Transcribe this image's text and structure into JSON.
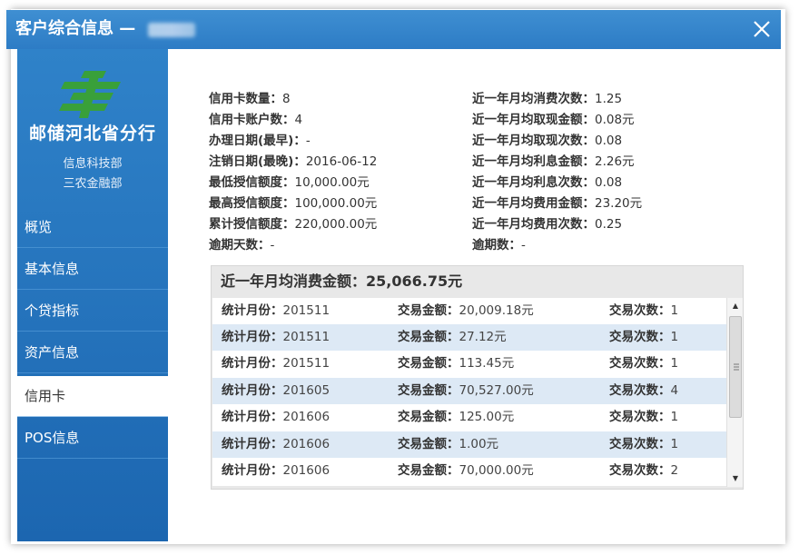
{
  "window": {
    "title": "客户综合信息 —",
    "close_icon": "close-icon"
  },
  "sidebar": {
    "org_name": "邮储河北省分行",
    "dept1": "信息科技部",
    "dept2": "三农金融部",
    "items": [
      {
        "label": "概览"
      },
      {
        "label": "基本信息"
      },
      {
        "label": "个贷指标"
      },
      {
        "label": "资产信息"
      },
      {
        "label": "信用卡"
      },
      {
        "label": "POS信息"
      }
    ],
    "active_index": 4
  },
  "info": {
    "left": [
      {
        "label": "信用卡数量：",
        "value": "8"
      },
      {
        "label": "信用卡账户数：",
        "value": "4"
      },
      {
        "label": "办理日期(最早)：",
        "value": "-"
      },
      {
        "label": "注销日期(最晚)：",
        "value": "2016-06-12"
      },
      {
        "label": "最低授信额度：",
        "value": "10,000.00元"
      },
      {
        "label": "最高授信额度：",
        "value": "100,000.00元"
      },
      {
        "label": "累计授信额度：",
        "value": "220,000.00元"
      },
      {
        "label": "逾期天数：",
        "value": "-"
      }
    ],
    "right": [
      {
        "label": "近一年月均消费次数：",
        "value": "1.25"
      },
      {
        "label": "近一年月均取现金额：",
        "value": "0.08元"
      },
      {
        "label": "近一年月均取现次数：",
        "value": "0.08"
      },
      {
        "label": "近一年月均利息金额：",
        "value": "2.26元"
      },
      {
        "label": "近一年月均利息次数：",
        "value": "0.08"
      },
      {
        "label": "近一年月均费用金额：",
        "value": "23.20元"
      },
      {
        "label": "近一年月均费用次数：",
        "value": "0.25"
      },
      {
        "label": "逾期数：",
        "value": "-"
      }
    ]
  },
  "panel": {
    "header": "近一年月均消费金额：25,066.75元",
    "col_labels": {
      "month": "统计月份：",
      "amount": "交易金额：",
      "count": "交易次数："
    },
    "rows": [
      {
        "month": "201511",
        "amount": "20,009.18元",
        "count": "1"
      },
      {
        "month": "201511",
        "amount": "27.12元",
        "count": "1"
      },
      {
        "month": "201511",
        "amount": "113.45元",
        "count": "1"
      },
      {
        "month": "201605",
        "amount": "70,527.00元",
        "count": "4"
      },
      {
        "month": "201606",
        "amount": "125.00元",
        "count": "1"
      },
      {
        "month": "201606",
        "amount": "1.00元",
        "count": "1"
      },
      {
        "month": "201606",
        "amount": "70,000.00元",
        "count": "2"
      }
    ]
  },
  "colors": {
    "titlebar": "#2d7cc5",
    "sidebar": "#1c66b0",
    "row_alt": "#dde9f5"
  }
}
